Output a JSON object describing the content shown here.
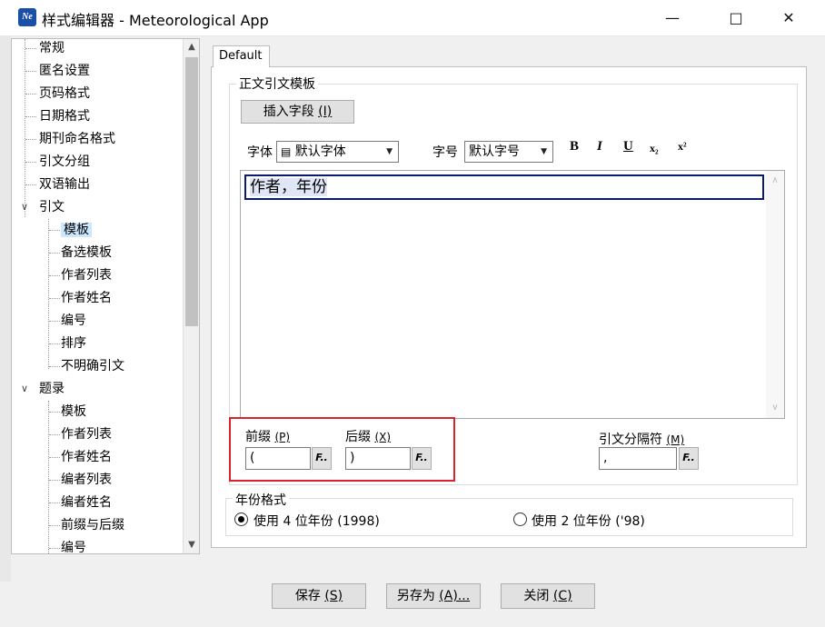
{
  "window": {
    "title": "样式编辑器 - Meteorological App",
    "icon_text": "Ne"
  },
  "tree": {
    "items": [
      {
        "label": "常规",
        "level": 0
      },
      {
        "label": "匿名设置",
        "level": 0
      },
      {
        "label": "页码格式",
        "level": 0
      },
      {
        "label": "日期格式",
        "level": 0
      },
      {
        "label": "期刊命名格式",
        "level": 0
      },
      {
        "label": "引文分组",
        "level": 0
      },
      {
        "label": "双语输出",
        "level": 0
      },
      {
        "label": "引文",
        "level": 0,
        "expanded": true
      },
      {
        "label": "模板",
        "level": 1,
        "selected": true
      },
      {
        "label": "备选模板",
        "level": 1
      },
      {
        "label": "作者列表",
        "level": 1
      },
      {
        "label": "作者姓名",
        "level": 1
      },
      {
        "label": "编号",
        "level": 1
      },
      {
        "label": "排序",
        "level": 1
      },
      {
        "label": "不明确引文",
        "level": 1
      },
      {
        "label": "题录",
        "level": 0,
        "expanded": true
      },
      {
        "label": "模板",
        "level": 1
      },
      {
        "label": "作者列表",
        "level": 1
      },
      {
        "label": "作者姓名",
        "level": 1
      },
      {
        "label": "编者列表",
        "level": 1
      },
      {
        "label": "编者姓名",
        "level": 1
      },
      {
        "label": "前缀与后缀",
        "level": 1
      },
      {
        "label": "编号",
        "level": 1
      }
    ]
  },
  "tab": {
    "label": "Default"
  },
  "template_group": {
    "legend": "正文引文模板",
    "insert_field_label": "插入字段",
    "insert_field_key": "(I)",
    "font_label": "字体",
    "font_value": "默认字体",
    "size_label": "字号",
    "size_value": "默认字号",
    "bold": "B",
    "italic": "I",
    "underline": "U",
    "subscript": "x₂",
    "superscript": "x²",
    "editor_text": "作者，年份"
  },
  "affix": {
    "prefix_label": "前缀",
    "prefix_key": "(P)",
    "prefix_value": "(",
    "suffix_label": "后缀",
    "suffix_key": "(X)",
    "suffix_value": ")",
    "separator_label": "引文分隔符",
    "separator_key": "(M)",
    "separator_value": ",",
    "f_button": "F.."
  },
  "year_group": {
    "legend": "年份格式",
    "option_4": "使用 4 位年份 (1998)",
    "option_2": "使用 2 位年份 ('98)",
    "selected": "option_4"
  },
  "buttons": {
    "save": "保存",
    "save_key": "(S)",
    "save_as": "另存为",
    "save_as_key": "(A)...",
    "close": "关闭",
    "close_key": "(C)"
  },
  "colors": {
    "highlight": "#d9232e",
    "selected_bg": "#cce8ff",
    "editor_border": "#0a1a6e"
  }
}
